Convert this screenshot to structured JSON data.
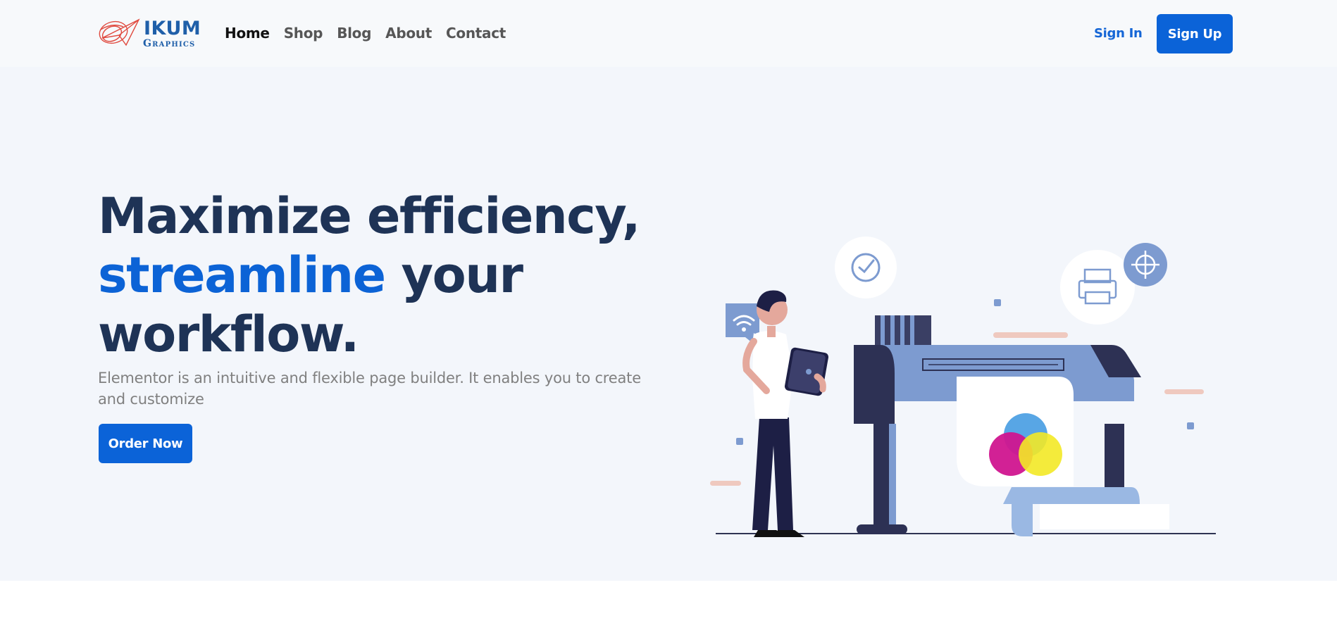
{
  "brand": {
    "name": "IKUM",
    "tagline": "Graphics",
    "logo_icon": "paper-plane-swirl-icon",
    "colors": {
      "logo_blue": "#1f5fa9",
      "logo_red": "#e04a3f"
    }
  },
  "nav": {
    "items": [
      {
        "label": "Home",
        "active": true
      },
      {
        "label": "Shop",
        "active": false
      },
      {
        "label": "Blog",
        "active": false
      },
      {
        "label": "About",
        "active": false
      },
      {
        "label": "Contact",
        "active": false
      }
    ]
  },
  "auth": {
    "sign_in_label": "Sign In",
    "sign_up_label": "Sign Up"
  },
  "hero": {
    "headline_part1": "Maximize efficiency,",
    "headline_accent": "streamline",
    "headline_part2": " your",
    "headline_part3": "workflow.",
    "subtext": "Elementor is an intuitive and flexible page builder. It enables you to create and customize",
    "cta_label": "Order Now"
  },
  "illustration": {
    "subject": "person-with-tablet-at-large-format-printer",
    "icons": [
      "wifi-icon",
      "clock-check-icon",
      "printer-icon",
      "crosshair-icon"
    ]
  },
  "colors": {
    "primary": "#0b63d8",
    "heading": "#1e3356",
    "hero_bg": "#f3f6fb",
    "header_bg": "#f7f9fb",
    "muted_text": "#808080"
  }
}
